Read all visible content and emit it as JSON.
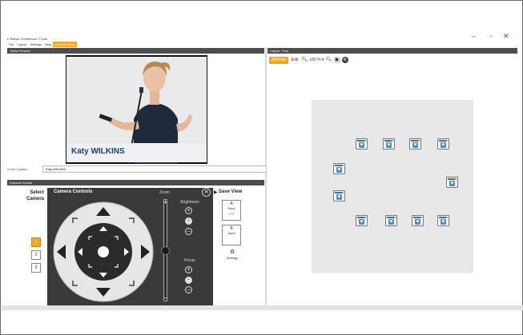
{
  "window": {
    "title": "s Televic Conference T-Cam",
    "minimize": "–",
    "maximize": "▫",
    "close": "✕"
  },
  "menu": [
    {
      "label": "File",
      "active": false
    },
    {
      "label": "Layout",
      "active": false
    },
    {
      "label": "Settings",
      "active": false
    },
    {
      "label": "Help",
      "active": false
    },
    {
      "label": "Meeting Mode",
      "active": true
    }
  ],
  "video_preview": {
    "header": "Video Preview",
    "speaker_name": "Katy WILKINS",
    "caption_label": "urrent Caption",
    "caption_value": "Katy WILKINS"
  },
  "layout_tool": {
    "header": "Layout - Tool",
    "activate_label": "Activate",
    "edit_label": "Edit",
    "zoom_value": "100 % ▾"
  },
  "camera_control": {
    "header": "Camera Control",
    "select_camera_label": "Select Camera",
    "cameras": [
      "1",
      "2",
      "3"
    ],
    "selected_camera": "1",
    "overlay_title": "Camera Controls",
    "zoom_label": "Zoom",
    "zoom_level": 0.5,
    "brightness_label": "Brightness",
    "focus_label": "Focus",
    "save_view_label": "Save View",
    "save_slots": [
      {
        "letter": "A",
        "label": "Save",
        "sub": "(view)"
      },
      {
        "letter": "B",
        "label": "Save",
        "sub": ""
      }
    ],
    "settings_label": "Settings"
  },
  "colors": {
    "accent": "#f5a623",
    "panel_header": "#4d4d4d",
    "overlay_bg": "#3a3a3a",
    "name_text": "#1b3f70",
    "seat_icon": "#4b8fd1"
  },
  "seats_count": 12
}
